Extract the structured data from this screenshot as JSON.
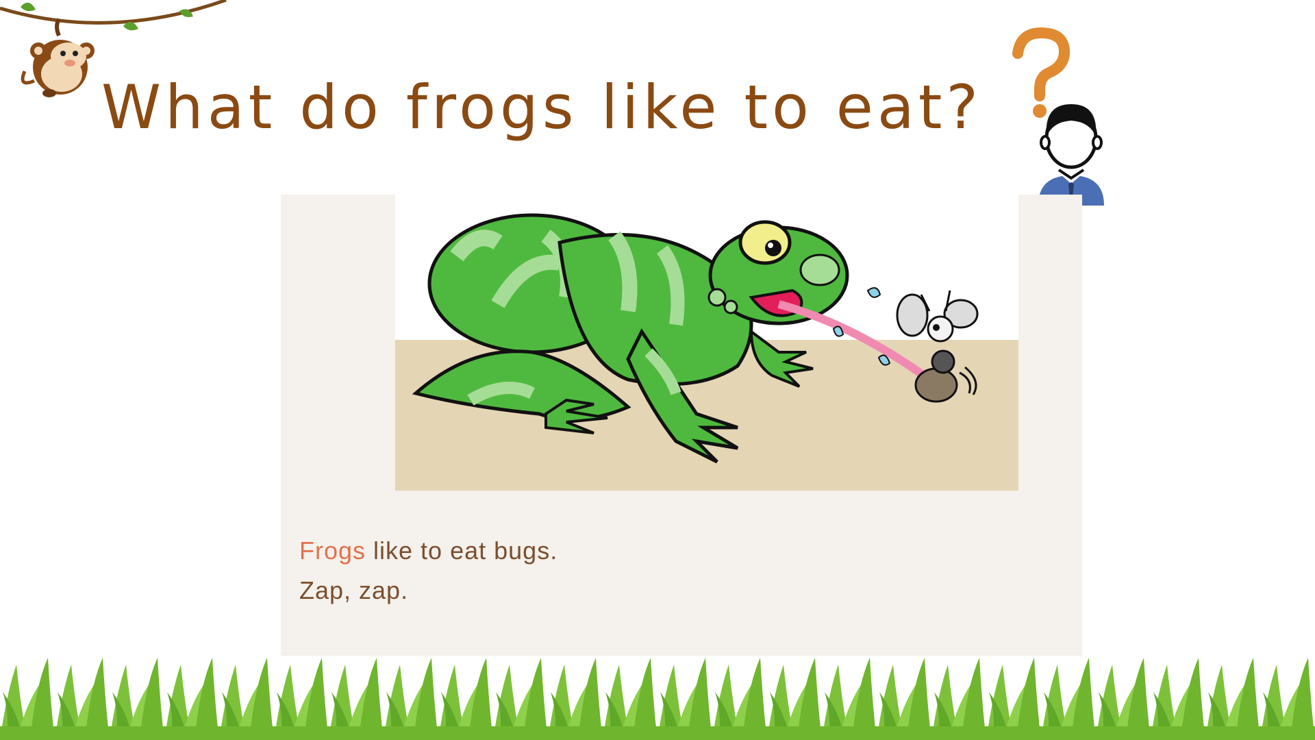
{
  "slide": {
    "title": "What do frogs like to eat?",
    "story": {
      "line1_highlight": "Frogs",
      "line1_rest": " like to eat bugs.",
      "line2": "Zap, zap."
    }
  },
  "colors": {
    "title": "#8a4a12",
    "highlight": "#e2714c",
    "body_text": "#7a4f2e",
    "panel": "#f5f1ec",
    "frog_green": "#4fb93f",
    "frog_light": "#a6dd96",
    "grass": "#7dc13a",
    "question_mark": "#e08a32",
    "shirt": "#4a6fb5"
  },
  "icons": [
    "monkey-icon",
    "vine-icon",
    "question-mark-icon",
    "person-icon",
    "frog-illustration",
    "bug-icon",
    "grass-border"
  ]
}
